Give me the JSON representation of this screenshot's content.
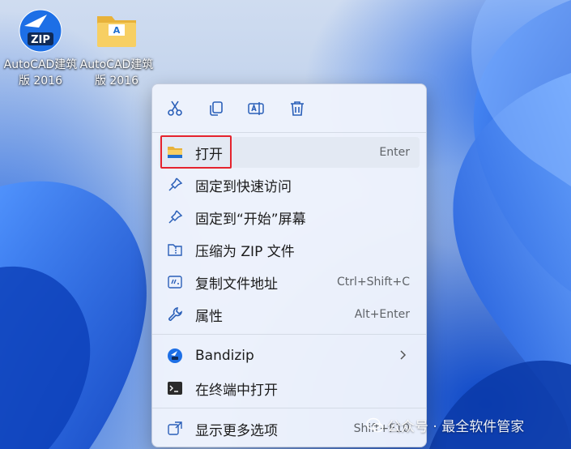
{
  "desktop": {
    "icons": [
      {
        "label": "AutoCAD建筑版 2016",
        "badge": "ZIP",
        "icon": "bandizip-zip-icon"
      },
      {
        "label": "AutoCAD建筑版 2016",
        "badge": "A",
        "icon": "folder-icon"
      }
    ]
  },
  "menu": {
    "toolbar": [
      {
        "name": "cut",
        "icon": "scissors-icon"
      },
      {
        "name": "copy",
        "icon": "copy-icon"
      },
      {
        "name": "rename",
        "icon": "rename-icon"
      },
      {
        "name": "delete",
        "icon": "trash-icon"
      }
    ],
    "items": [
      {
        "label": "打开",
        "shortcut": "Enter",
        "icon": "folder-icon"
      },
      {
        "label": "固定到快速访问",
        "shortcut": "",
        "icon": "pin-icon"
      },
      {
        "label": "固定到“开始”屏幕",
        "shortcut": "",
        "icon": "pin-icon"
      },
      {
        "label": "压缩为 ZIP 文件",
        "shortcut": "",
        "icon": "zip-folder-icon"
      },
      {
        "label": "复制文件地址",
        "shortcut": "Ctrl+Shift+C",
        "icon": "path-icon"
      },
      {
        "label": "属性",
        "shortcut": "Alt+Enter",
        "icon": "wrench-icon"
      },
      {
        "label": "Bandizip",
        "shortcut": "",
        "icon": "bandizip-icon"
      },
      {
        "label": "在终端中打开",
        "shortcut": "",
        "icon": "terminal-icon"
      },
      {
        "label": "显示更多选项",
        "shortcut": "Shift+F10",
        "icon": "more-options-icon"
      }
    ]
  },
  "watermark": {
    "text": "公众号 · 最全软件管家"
  },
  "colors": {
    "accent": "#1a6be0",
    "highlight_box": "#e5232d"
  }
}
